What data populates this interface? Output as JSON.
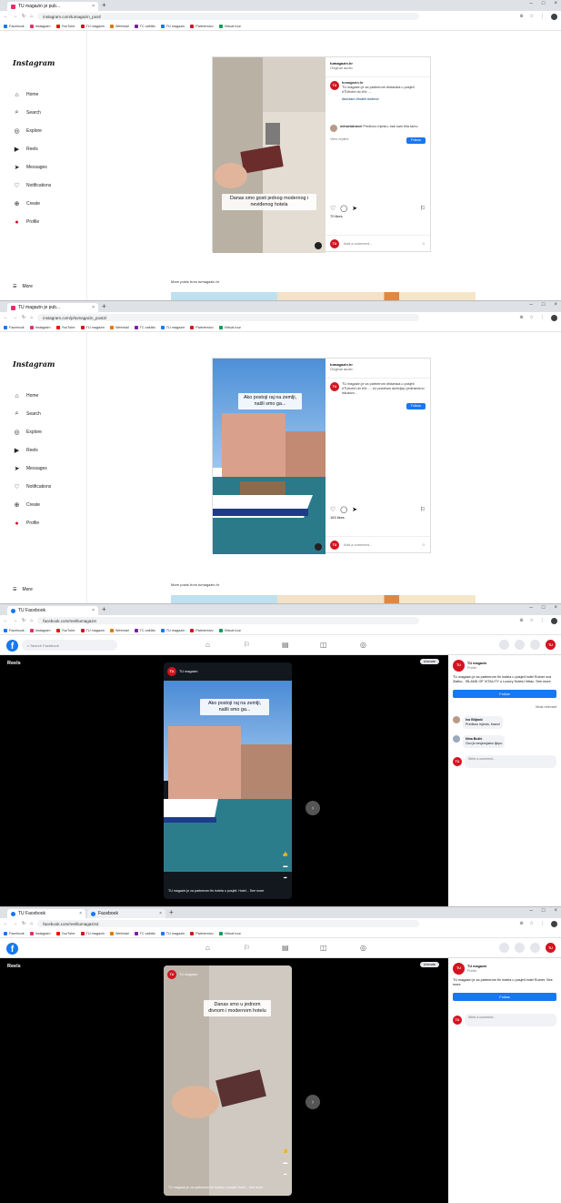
{
  "panel1": {
    "tab_title": "TU magazin je pub...",
    "url": "instagram.com/tumagazin_post/",
    "bookmarks": [
      "Facebook",
      "Instagram",
      "YouTube",
      "TU magazin",
      "Webmail",
      "TC zaštito",
      "TU magazin",
      "Partnerstvo",
      "Virtual tour"
    ],
    "logo": "Instagram",
    "nav": [
      "Home",
      "Search",
      "Explore",
      "Reels",
      "Messages",
      "Notifications",
      "Create",
      "Profile"
    ],
    "more": "More",
    "username": "tumagazin.hr",
    "audio": "Original audio",
    "caption_author": "tumagazin.hr",
    "caption": "TU magazin je za partnerom #Istarska u posjeti #TUhotel do #Vr.....",
    "hashtags": "#turizam #hoteli #odmor",
    "comment_user": "mihaelatravel",
    "comment_text": "Predivno mjesto, baš sam bila tamo",
    "view_replies": "View replies",
    "follow_btn": "Follow",
    "likes": "70 likes",
    "add_comment": "Add a comment...",
    "overlay": "Danas smo gosti jednog modernog i neviđenog hotela",
    "more_posts": "More posts from tumagazin.hr"
  },
  "panel2": {
    "tab_title": "TU magazin je pub...",
    "url": "instagram.com/p/tumagazin_post2/",
    "logo": "Instagram",
    "nav": [
      "Home",
      "Search",
      "Explore",
      "Reels",
      "Messages",
      "Notifications",
      "Create",
      "Profile"
    ],
    "more": "More",
    "username": "tumagazin.hr",
    "audio": "Original audio",
    "caption": "TU magazin je za partnerom #Istarska u posjeti #TUhotel do #Vr..... Uz poseban doživljaj i jedinstveno iskustvo...",
    "follow_btn": "Follow",
    "likes": "163 likes",
    "add_comment": "Add a comment...",
    "overlay": "Ako postoji raj na zemlji, našli smo ga...",
    "more_posts": "More posts from tumagazin.hr"
  },
  "panel3": {
    "tab_title": "TU Facebook",
    "url": "facebook.com/reel/tumagazin",
    "search": "Search Facebook",
    "reels": "Reels",
    "page": "TU magazin",
    "unmute": "Unmute",
    "reel_caption": "TU magazin je za partnerom fin hotela u posjeti. Hotel... See more",
    "overlay": "Ako postoji raj na zemlji, našli smo ga...",
    "side_title": "TU magazin",
    "side_sub": "Public",
    "side_text": "TU magazin je za partnerom fin hotela u posjeti hotel Ruiner sva Zlatko - ISLAND OF VITALITY u Luxury Hotelu Vrtlac. See more",
    "follow": "Follow",
    "most_relevant": "Most relevant",
    "comments": [
      {
        "name": "Ivo Biljanić",
        "text": "Predivno mjesto, bravo!"
      },
      {
        "name": "Nina Božić",
        "text": "Ovo je nevjerojatno lijepo"
      }
    ],
    "write": "Write a comment..."
  },
  "panel4": {
    "tab_title": "TU Facebook",
    "url": "facebook.com/reel/tumagazin2",
    "search": "Facebook",
    "reels": "Reels",
    "page": "TU magazin",
    "unmute": "Unmute",
    "reel_caption": "TU magazin je za partnerom fin hotela u posjeti Hotel... See more",
    "overlay": "Danas smo u jednom divnom i modernom hotelu",
    "side_title": "TU magazin",
    "side_sub": "Public",
    "side_text": "TU magazin je za partnerom fin hotela u posjeti hotel Ruiner. See more",
    "follow": "Follow",
    "write": "Write a comment..."
  },
  "colors": {
    "ig_accent": "#0095f6",
    "fb_blue": "#1877f2",
    "brand_red": "#d3131f"
  }
}
